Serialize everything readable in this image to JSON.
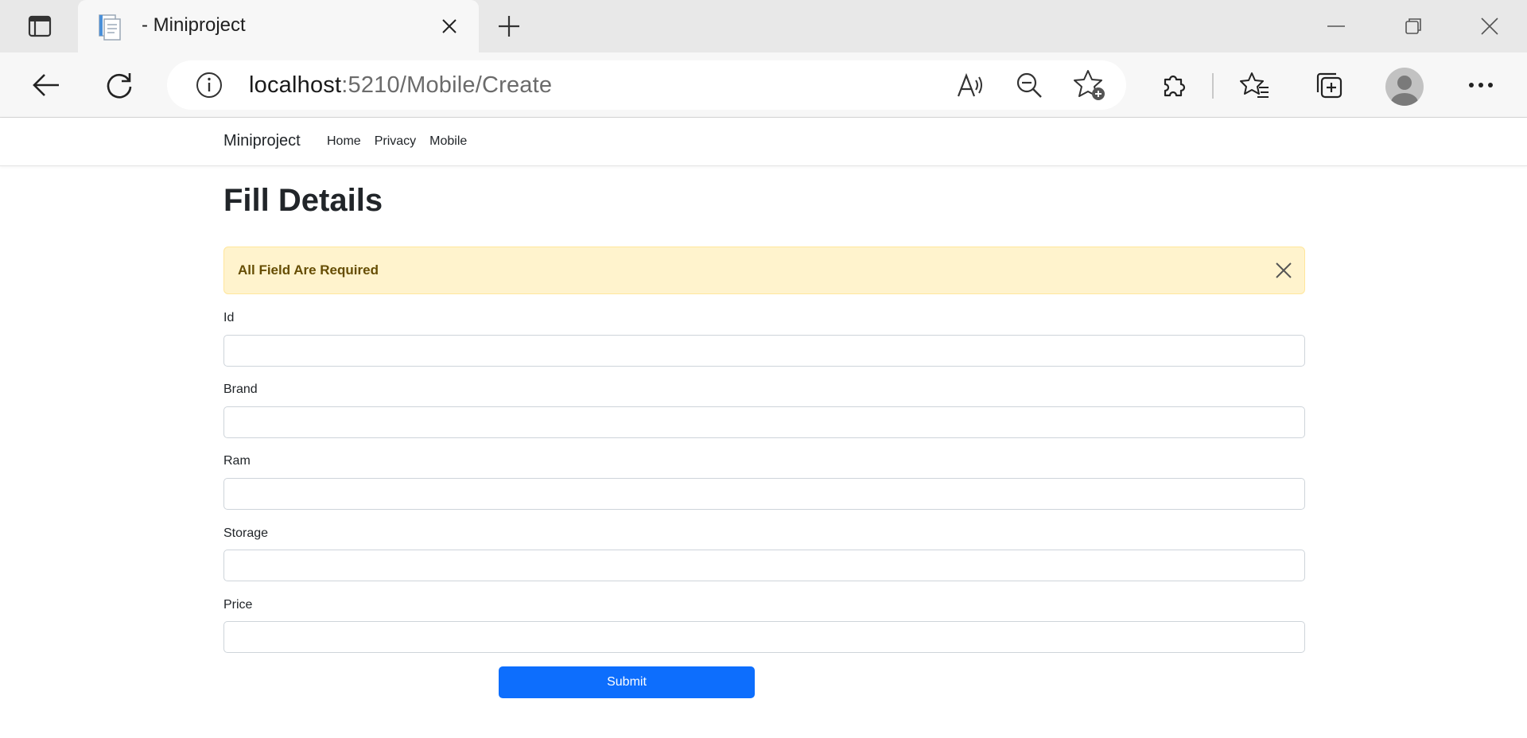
{
  "browser": {
    "tab_title": "- Miniproject",
    "url_host": "localhost",
    "url_path": ":5210/Mobile/Create"
  },
  "nav": {
    "brand": "Miniproject",
    "links": [
      "Home",
      "Privacy",
      "Mobile"
    ]
  },
  "page": {
    "title": "Fill Details",
    "alert": "All Field Are Required",
    "fields": [
      {
        "label": "Id",
        "value": ""
      },
      {
        "label": "Brand",
        "value": ""
      },
      {
        "label": "Ram",
        "value": ""
      },
      {
        "label": "Storage",
        "value": ""
      },
      {
        "label": "Price",
        "value": ""
      }
    ],
    "submit_label": "Submit"
  },
  "colors": {
    "primary": "#0d6efd",
    "alert_bg": "#fff3cd",
    "alert_text": "#664d03"
  }
}
